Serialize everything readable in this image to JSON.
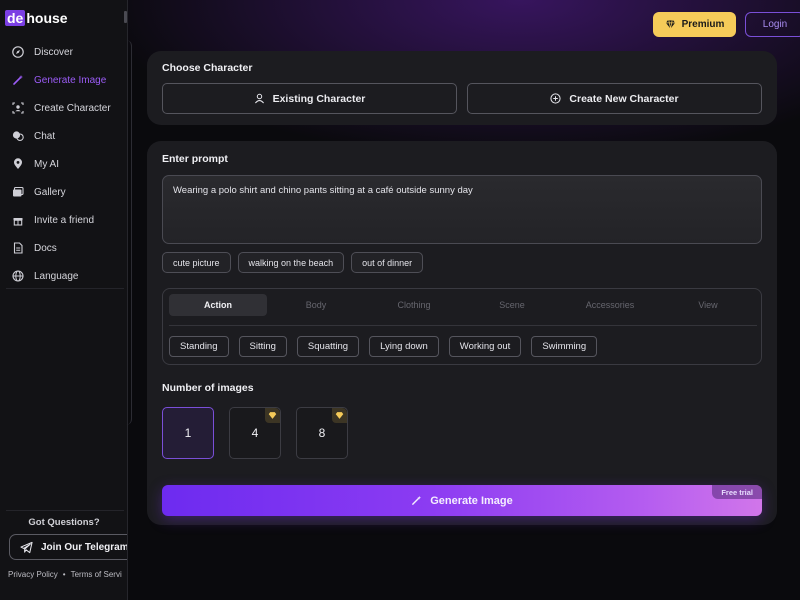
{
  "brand": {
    "logo_part1": "de",
    "logo_part2": "house"
  },
  "sidebar": {
    "items": [
      {
        "label": "Discover",
        "icon": "compass-icon"
      },
      {
        "label": "Generate Image",
        "icon": "magic-wand-icon",
        "active": true
      },
      {
        "label": "Create Character",
        "icon": "user-frame-icon"
      },
      {
        "label": "Chat",
        "icon": "chat-bubbles-icon"
      },
      {
        "label": "My AI",
        "icon": "map-pin-icon"
      },
      {
        "label": "Gallery",
        "icon": "gallery-icon"
      },
      {
        "label": "Invite a friend",
        "icon": "gift-icon"
      },
      {
        "label": "Docs",
        "icon": "document-icon"
      },
      {
        "label": "Language",
        "icon": "globe-icon"
      }
    ],
    "got_questions": "Got Questions?",
    "telegram_label": "Join Our Telegram",
    "privacy_label": "Privacy Policy",
    "dot": "•",
    "terms_label": "Terms of Servi"
  },
  "header": {
    "premium_label": "Premium",
    "login_label": "Login"
  },
  "choose_character": {
    "title": "Choose Character",
    "existing_label": "Existing Character",
    "create_label": "Create New Character"
  },
  "prompt": {
    "title": "Enter prompt",
    "value": "Wearing a polo shirt and chino pants sitting at a café outside sunny day",
    "suggestions": [
      "cute picture",
      "walking on the beach",
      "out of dinner"
    ]
  },
  "pose_tabs": {
    "tabs": [
      "Action",
      "Body",
      "Clothing",
      "Scene",
      "Accessories",
      "View"
    ],
    "active_tab": "Action",
    "options": [
      "Standing",
      "Sitting",
      "Squatting",
      "Lying down",
      "Working out",
      "Swimming"
    ]
  },
  "num_images": {
    "title": "Number of images",
    "options": [
      "1",
      "4",
      "8"
    ],
    "selected": "1"
  },
  "generate": {
    "label": "Generate Image",
    "badge": "Free trial"
  },
  "colors": {
    "accent": "#7b3fe4",
    "premium": "#f6cb59",
    "card": "#1c1c20"
  }
}
